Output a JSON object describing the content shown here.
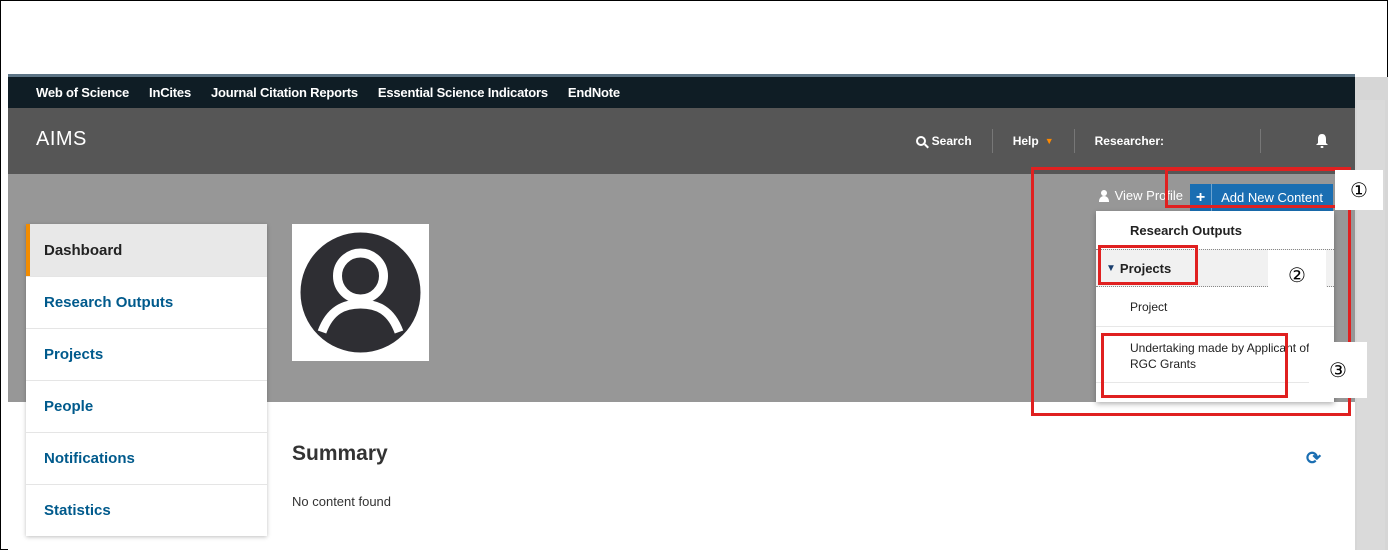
{
  "topnav": {
    "links": [
      "Web of Science",
      "InCites",
      "Journal Citation Reports",
      "Essential Science Indicators",
      "EndNote"
    ]
  },
  "header": {
    "logo": "AIMS",
    "search_label": "Search",
    "help_label": "Help",
    "researcher_label": "Researcher:",
    "help_caret": "▼"
  },
  "profile": {
    "view_profile": "View Profile",
    "add_new_content": "Add New Content",
    "add_plus": "+"
  },
  "dropdown": {
    "header": "Research Outputs",
    "group": "Projects",
    "group_marker": "▼",
    "items": [
      "Project",
      "Undertaking made by Applicant of RGC Grants"
    ]
  },
  "sidebar": {
    "items": [
      "Dashboard",
      "Research Outputs",
      "Projects",
      "People",
      "Notifications",
      "Statistics"
    ]
  },
  "summary": {
    "title": "Summary",
    "empty_text": "No content found",
    "refresh_glyph": "⟳"
  },
  "annotations": {
    "n1": "①",
    "n2": "②",
    "n3": "③"
  },
  "colors": {
    "top_bar": "#0f1d25",
    "header": "#565656",
    "band": "#979797",
    "accent_blue": "#1a6eb2",
    "active_orange": "#f28c00",
    "highlight_red": "#e02020"
  }
}
